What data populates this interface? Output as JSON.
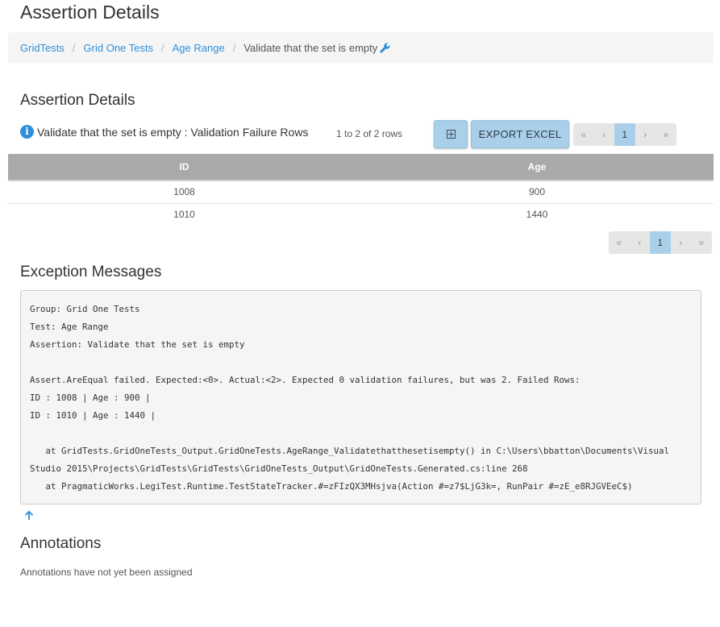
{
  "page": {
    "title": "Assertion Details"
  },
  "breadcrumb": {
    "items": [
      "GridTests",
      "Grid One Tests",
      "Age Range"
    ],
    "separator": "/",
    "current": "Validate that the set is empty",
    "edit_icon": "wrench-icon"
  },
  "details": {
    "title": "Assertion Details",
    "info_icon": "info-icon",
    "info_glyph": "i",
    "caption": "Validate that the set is empty : Validation Failure Rows",
    "row_count": "1 to 2 of 2 rows",
    "column_toggle_icon": "plus-square-icon",
    "export_label": "EXPORT EXCEL",
    "pager": {
      "first": "«",
      "prev": "‹",
      "current": "1",
      "next": "›",
      "last": "»"
    },
    "columns": [
      "ID",
      "Age"
    ],
    "rows": [
      [
        "1008",
        "900"
      ],
      [
        "1010",
        "1440"
      ]
    ]
  },
  "exceptions": {
    "title": "Exception Messages",
    "lines": [
      "Group: Grid One Tests",
      "Test: Age Range",
      "Assertion: Validate that the set is empty",
      "",
      "Assert.AreEqual failed. Expected:<0>. Actual:<2>. Expected 0 validation failures, but was 2. Failed Rows:",
      "ID : 1008 | Age : 900 |",
      "ID : 1010 | Age : 1440 |",
      "",
      "   at GridTests.GridOneTests_Output.GridOneTests.AgeRange_Validatethatthesetisempty() in C:\\Users\\bbatton\\Documents\\Visual Studio 2015\\Projects\\GridTests\\GridTests\\GridOneTests_Output\\GridOneTests.Generated.cs:line 268",
      "   at PragmaticWorks.LegiTest.Runtime.TestStateTracker.#=zFIzQX3MHsjva(Action #=z7$LjG3k=, RunPair #=zE_e8RJGVEeC$)"
    ],
    "back_to_top_icon": "arrow-up-icon"
  },
  "annotations": {
    "title": "Annotations",
    "empty_text": "Annotations have not yet been assigned"
  },
  "colors": {
    "link": "#2f8fd9",
    "button": "#a9cfe9",
    "table_header": "#a9a9a9",
    "breadcrumb_bg": "#f5f5f5"
  }
}
